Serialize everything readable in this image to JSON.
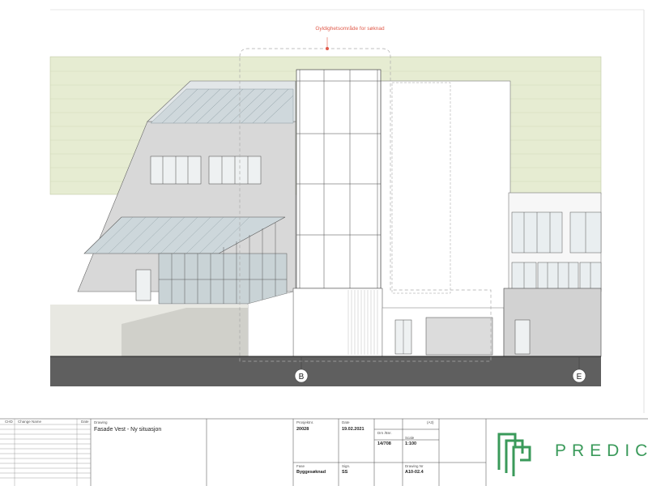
{
  "annotation": {
    "validity_area": "Gyldighetsområde for søknad",
    "accent": "#e05a4a"
  },
  "gridlines": {
    "b": "B",
    "e": "E"
  },
  "revision_table": {
    "headers": [
      "CHD",
      "Change Name",
      "Date"
    ]
  },
  "title_block": {
    "drawing_label": "Drawing",
    "drawing_title": "Fasade Vest -  Ny situasjon",
    "project_label": "Prosjektnr.",
    "project_no": "20028",
    "date_label": "Date",
    "date": "19.02.2021",
    "sheet_size": "(A3)",
    "drn_label": "Drn /Bnr.",
    "drn": "14/708",
    "scale_label": "Scale",
    "scale": "1:100",
    "phase_label": "Fase",
    "phase": "Byggesøknad",
    "sign_label": "Sign.",
    "sign": "SS",
    "drawing_no_label": "Drawing Nr",
    "drawing_no": "A10-02.4"
  },
  "logo": {
    "wordmark": "PREDIC",
    "color": "#3a9a5a",
    "icon": "predico-logo-icon"
  },
  "colors": {
    "ground": "#5f5f5f",
    "hedge": "#e6ecd2",
    "wall": "#d8d8d8",
    "glass": "#c9d3d6"
  }
}
